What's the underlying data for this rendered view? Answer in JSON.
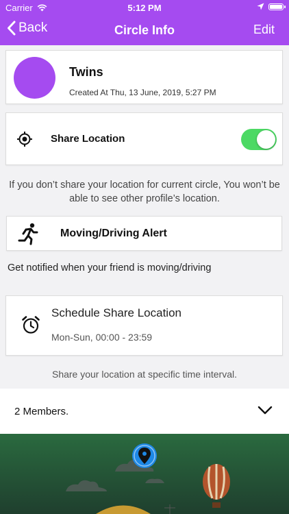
{
  "status_bar": {
    "carrier": "Carrier",
    "time": "5:12 PM"
  },
  "nav": {
    "back_label": "Back",
    "title": "Circle Info",
    "edit_label": "Edit"
  },
  "circle": {
    "name": "Twins",
    "created_at": "Created At  Thu, 13 June, 2019, 5:27 PM",
    "avatar_color": "#a54bf0"
  },
  "share_location": {
    "label": "Share Location",
    "enabled": true
  },
  "share_info": "If you don’t share your location for current circle, You won’t be able to see other profile’s location.",
  "moving_alert": {
    "label": "Moving/Driving Alert"
  },
  "notify_text": "Get notified when your friend is moving/driving",
  "schedule": {
    "title": "Schedule Share Location",
    "range": "Mon-Sun, 00:00 - 23:59"
  },
  "schedule_note": "Share your location at specific time interval.",
  "members": {
    "label": "2 Members."
  },
  "colors": {
    "accent": "#a54bf0",
    "toggle_on": "#4cd964",
    "pin": "#1e88e5",
    "illustration_bg": "#2a6a3f"
  }
}
